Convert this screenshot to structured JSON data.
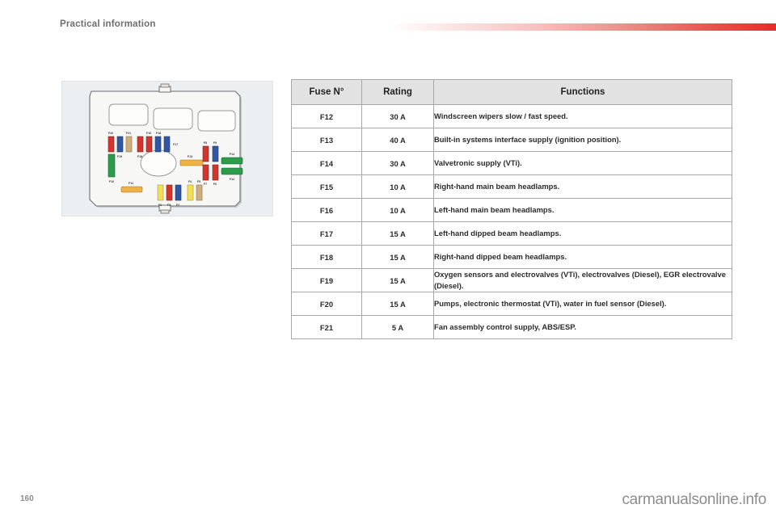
{
  "header": {
    "section_title": "Practical information",
    "rule_color_start": "#ffffff",
    "rule_color_end": "#e42b31"
  },
  "footer": {
    "page_number": "160",
    "watermark": "carmanualsonline.info"
  },
  "fusebox": {
    "name": "engine-compartment-fuse-box-diagram",
    "labels": [
      "F20",
      "F19",
      "F21",
      "F18",
      "F16",
      "F18",
      "F17",
      "F10",
      "F13",
      "F8",
      "F9",
      "F14",
      "F7",
      "F6",
      "F12",
      "F11",
      "F1",
      "F3",
      "F2",
      "F4",
      "F5"
    ],
    "fuse_colors": {
      "red": "#d3352e",
      "blue": "#2f57a6",
      "tan": "#cfae7c",
      "green": "#2a9c4a",
      "yellow": "#f2df56",
      "orange": "#eeb14a"
    }
  },
  "table": {
    "headers": {
      "fuse": "Fuse N°",
      "rating": "Rating",
      "functions": "Functions"
    },
    "rows": [
      {
        "fuse": "F12",
        "rating": "30 A",
        "functions": "Windscreen wipers slow / fast speed."
      },
      {
        "fuse": "F13",
        "rating": "40 A",
        "functions": "Built-in systems interface supply (ignition position)."
      },
      {
        "fuse": "F14",
        "rating": "30 A",
        "functions": "Valvetronic supply (VTi)."
      },
      {
        "fuse": "F15",
        "rating": "10 A",
        "functions": "Right-hand main beam headlamps."
      },
      {
        "fuse": "F16",
        "rating": "10 A",
        "functions": "Left-hand main beam headlamps."
      },
      {
        "fuse": "F17",
        "rating": "15 A",
        "functions": "Left-hand dipped beam headlamps."
      },
      {
        "fuse": "F18",
        "rating": "15 A",
        "functions": "Right-hand dipped beam headlamps."
      },
      {
        "fuse": "F19",
        "rating": "15 A",
        "functions": "Oxygen sensors and electrovalves (VTi), electrovalves (Diesel), EGR electrovalve (Diesel)."
      },
      {
        "fuse": "F20",
        "rating": "15 A",
        "functions": "Pumps, electronic thermostat (VTi), water in fuel sensor (Diesel)."
      },
      {
        "fuse": "F21",
        "rating": "5 A",
        "functions": "Fan assembly control supply, ABS/ESP."
      }
    ]
  }
}
